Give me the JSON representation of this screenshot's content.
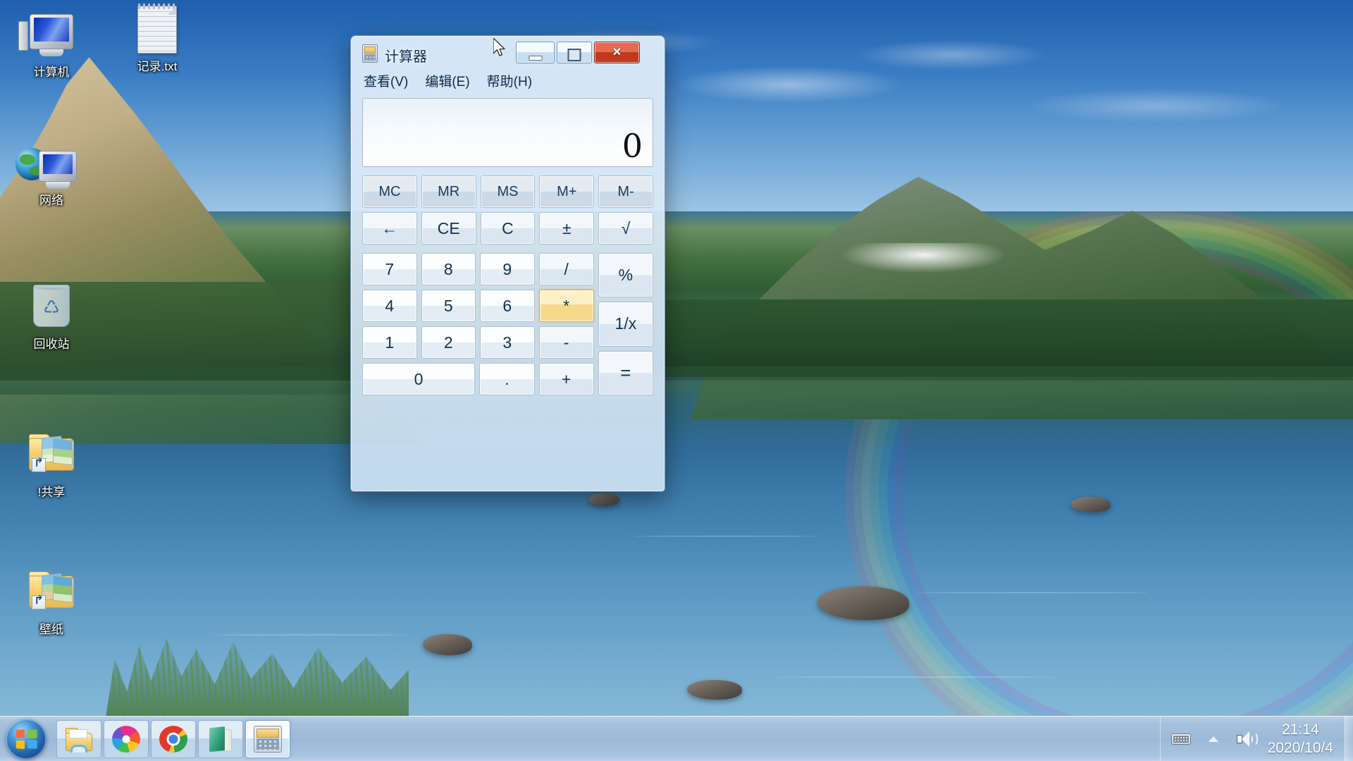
{
  "desktop": {
    "icons": [
      {
        "label": "计算机",
        "icon": "computer-icon"
      },
      {
        "label": "记录.txt",
        "icon": "text-file-icon"
      },
      {
        "label": "网络",
        "icon": "network-icon"
      },
      {
        "label": "回收站",
        "icon": "recycle-bin-icon"
      },
      {
        "label": "!共享",
        "icon": "folder-shortcut-icon"
      },
      {
        "label": "壁纸",
        "icon": "folder-shortcut-icon"
      }
    ]
  },
  "calculator": {
    "title": "计算器",
    "icon": "calculator-icon",
    "window_buttons": {
      "minimize": "minimize-icon",
      "maximize": "maximize-icon",
      "close": "×"
    },
    "menu": [
      {
        "label": "查看(V)"
      },
      {
        "label": "编辑(E)"
      },
      {
        "label": "帮助(H)"
      }
    ],
    "display": {
      "value": "0"
    },
    "memory_row": [
      "MC",
      "MR",
      "MS",
      "M+",
      "M-"
    ],
    "function_row": [
      "←",
      "CE",
      "C",
      "±",
      "√"
    ],
    "digits": {
      "row1": [
        "7",
        "8",
        "9"
      ],
      "row2": [
        "4",
        "5",
        "6"
      ],
      "row3": [
        "1",
        "2",
        "3"
      ],
      "row4": [
        "0",
        "."
      ]
    },
    "operators": {
      "divide": "/",
      "percent": "%",
      "multiply": "*",
      "reciprocal": "1/x",
      "minus": "-",
      "plus": "+",
      "equals": "="
    },
    "hovered_key": "*",
    "colors": {
      "hover_accent": "#f7d98d",
      "close_button": "#c23a1c",
      "window_chrome": "#cde1f3"
    }
  },
  "taskbar": {
    "start_button": "start-orb-icon",
    "items": [
      {
        "name": "file-explorer",
        "icon": "folder-icon",
        "active": false
      },
      {
        "name": "pinwheel-browser",
        "icon": "pinwheel-icon",
        "active": false
      },
      {
        "name": "chrome",
        "icon": "chrome-icon",
        "active": false
      },
      {
        "name": "green-book-app",
        "icon": "book-icon",
        "active": false
      },
      {
        "name": "calculator",
        "icon": "calculator-icon",
        "active": true
      }
    ],
    "tray": {
      "keyboard": "keyboard-icon",
      "show_hidden": "chevron-up-icon",
      "volume": "volume-icon"
    },
    "clock": {
      "time": "21:14",
      "date": "2020/10/4"
    }
  }
}
